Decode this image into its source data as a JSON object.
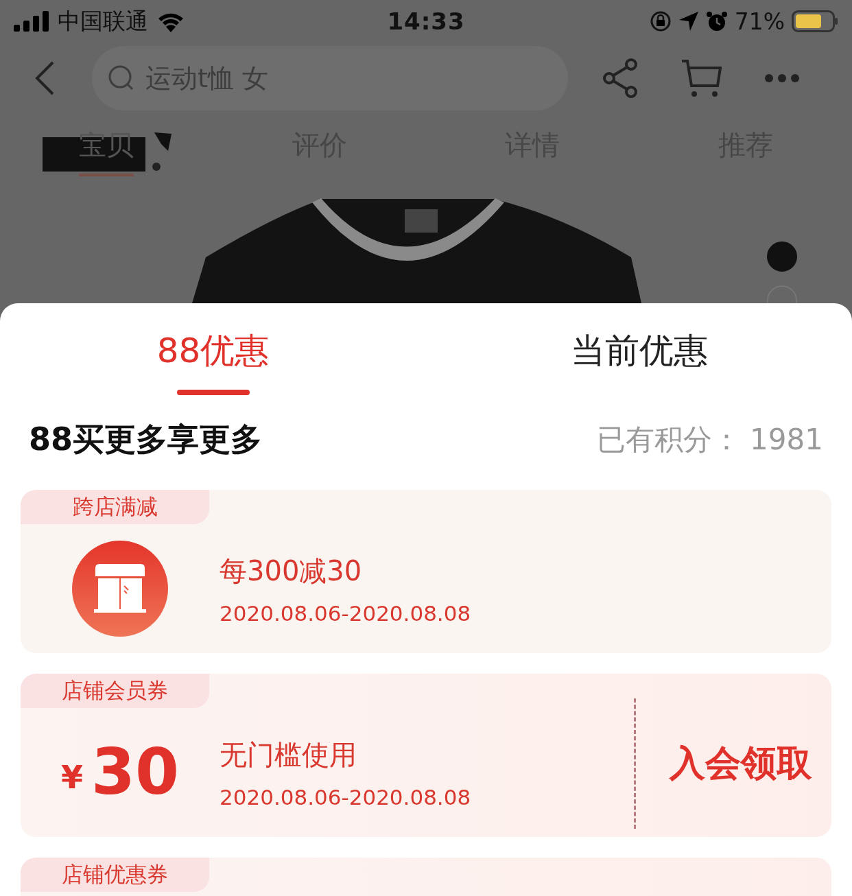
{
  "status_bar": {
    "carrier": "中国联通",
    "time": "14:33",
    "battery": "71%"
  },
  "nav": {
    "search": {
      "value": "运动t恤 女"
    }
  },
  "product_tabs": [
    {
      "label": "宝贝",
      "selected": true
    },
    {
      "label": "评价",
      "selected": false
    },
    {
      "label": "详情",
      "selected": false
    },
    {
      "label": "推荐",
      "selected": false
    }
  ],
  "gallery": {
    "kind": "picture",
    "slides": [
      {
        "selected": true
      },
      {
        "selected": false
      }
    ]
  },
  "sheet": {
    "tabs": [
      {
        "label": "88优惠",
        "selected": true
      },
      {
        "label": "当前优惠",
        "selected": false
      }
    ],
    "heading": "88买更多享更多",
    "points": "已有积分： 1981",
    "coupons": [
      {
        "kind": "store",
        "tag": "跨店满减",
        "title": "每300减30",
        "date": "2020.08.06-2020.08.08"
      },
      {
        "kind": "cash",
        "tag": "店铺会员券",
        "currency": "¥",
        "amount": "30",
        "title": "无门槛使用",
        "date": "2020.08.06-2020.08.08",
        "action": "入会领取"
      },
      {
        "kind": "cash",
        "tag": "店铺优惠券"
      }
    ]
  }
}
